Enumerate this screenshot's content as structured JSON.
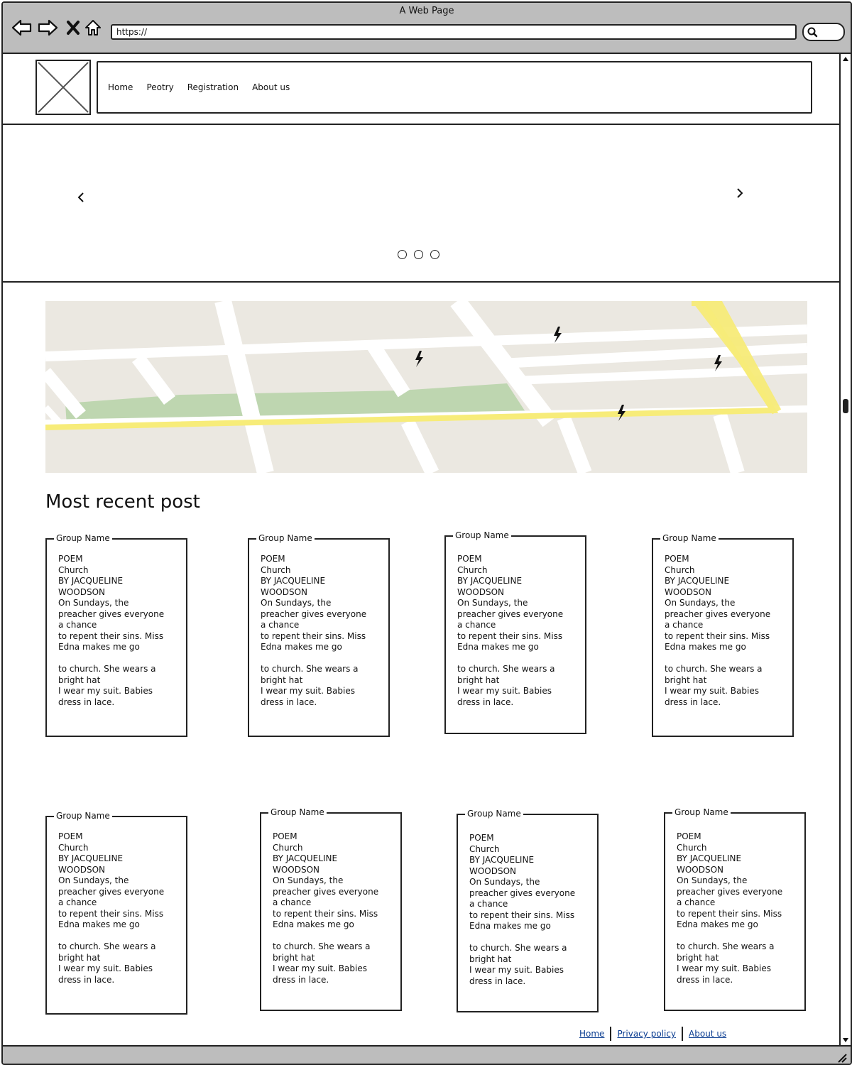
{
  "browser": {
    "title": "A Web Page",
    "url": "https://"
  },
  "nav": {
    "items": [
      "Home",
      "Peotry",
      "Registration",
      "About us"
    ]
  },
  "section": {
    "title": "Most recent post"
  },
  "groups": [
    {
      "legend": "Group Name",
      "poem": "POEM\nChurch\nBY JACQUELINE\nWOODSON\nOn Sundays, the\npreacher gives everyone\na chance\nto repent their sins. Miss\nEdna makes me go\n\nto church. She wears a\nbright hat\nI wear my suit. Babies\ndress in lace."
    },
    {
      "legend": "Group Name",
      "poem": "POEM\nChurch\nBY JACQUELINE\nWOODSON\nOn Sundays, the\npreacher gives everyone\na chance\nto repent their sins. Miss\nEdna makes me go\n\nto church. She wears a\nbright hat\nI wear my suit. Babies\ndress in lace."
    },
    {
      "legend": "Group Name",
      "poem": "POEM\nChurch\nBY JACQUELINE\nWOODSON\nOn Sundays, the\npreacher gives everyone\na chance\nto repent their sins. Miss\nEdna makes me go\n\nto church. She wears a\nbright hat\nI wear my suit. Babies\ndress in lace."
    },
    {
      "legend": "Group Name",
      "poem": "POEM\nChurch\nBY JACQUELINE\nWOODSON\nOn Sundays, the\npreacher gives everyone\na chance\nto repent their sins. Miss\nEdna makes me go\n\nto church. She wears a\nbright hat\nI wear my suit. Babies\ndress in lace."
    },
    {
      "legend": "Group Name",
      "poem": "POEM\nChurch\nBY JACQUELINE\nWOODSON\nOn Sundays, the\npreacher gives everyone\na chance\nto repent their sins. Miss\nEdna makes me go\n\nto church. She wears a\nbright hat\nI wear my suit. Babies\ndress in lace."
    },
    {
      "legend": "Group Name",
      "poem": "POEM\nChurch\nBY JACQUELINE\nWOODSON\nOn Sundays, the\npreacher gives everyone\na chance\nto repent their sins. Miss\nEdna makes me go\n\nto church. She wears a\nbright hat\nI wear my suit. Babies\ndress in lace."
    },
    {
      "legend": "Group Name",
      "poem": "POEM\nChurch\nBY JACQUELINE\nWOODSON\nOn Sundays, the\npreacher gives everyone\na chance\nto repent their sins. Miss\nEdna makes me go\n\nto church. She wears a\nbright hat\nI wear my suit. Babies\ndress in lace."
    },
    {
      "legend": "Group Name",
      "poem": "POEM\nChurch\nBY JACQUELINE\nWOODSON\nOn Sundays, the\npreacher gives everyone\na chance\nto repent their sins. Miss\nEdna makes me go\n\nto church. She wears a\nbright hat\nI wear my suit. Babies\ndress in lace."
    }
  ],
  "footer": {
    "links": [
      "Home",
      "Privacy policy",
      "About us"
    ]
  },
  "icons": {
    "back": "back-arrow-icon",
    "forward": "forward-arrow-icon",
    "stop": "close-icon",
    "home": "home-icon",
    "search": "search-icon",
    "map_markers": "lightning-marker-icon"
  },
  "colors": {
    "chrome": "#bdbdbd",
    "map_land": "#ebe8e1",
    "map_park": "#bed6b0",
    "map_highway": "#f7ec79",
    "link": "#0b3d91"
  }
}
